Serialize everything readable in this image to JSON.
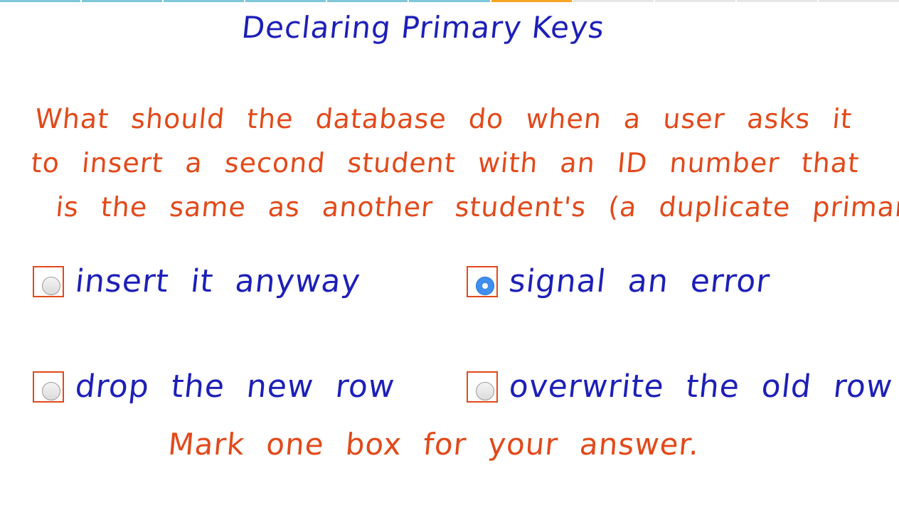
{
  "progress": {
    "total_segments": 11,
    "completed_segments": 6,
    "current_segment": 7,
    "colors": {
      "done": "#7ec8d8",
      "current": "#f5a623",
      "pending": "#e6e6e6"
    }
  },
  "title": "Declaring Primary Keys",
  "question": {
    "line1": "What should the database do when a user asks it",
    "line2": "to insert a second student with an ID number that",
    "line3": "is the same as another student's (a duplicate primary key)?"
  },
  "options": [
    {
      "label": "insert it anyway",
      "selected": false
    },
    {
      "label": "signal an error",
      "selected": true
    },
    {
      "label": "drop the new row",
      "selected": false
    },
    {
      "label": "overwrite the old row",
      "selected": false
    }
  ],
  "instruction": "Mark one box for your answer.",
  "colors": {
    "question_text": "#e2491a",
    "answer_text": "#1d1fb8",
    "checkbox_border": "#e2491a",
    "radio_selected": "#3f8ef0"
  }
}
